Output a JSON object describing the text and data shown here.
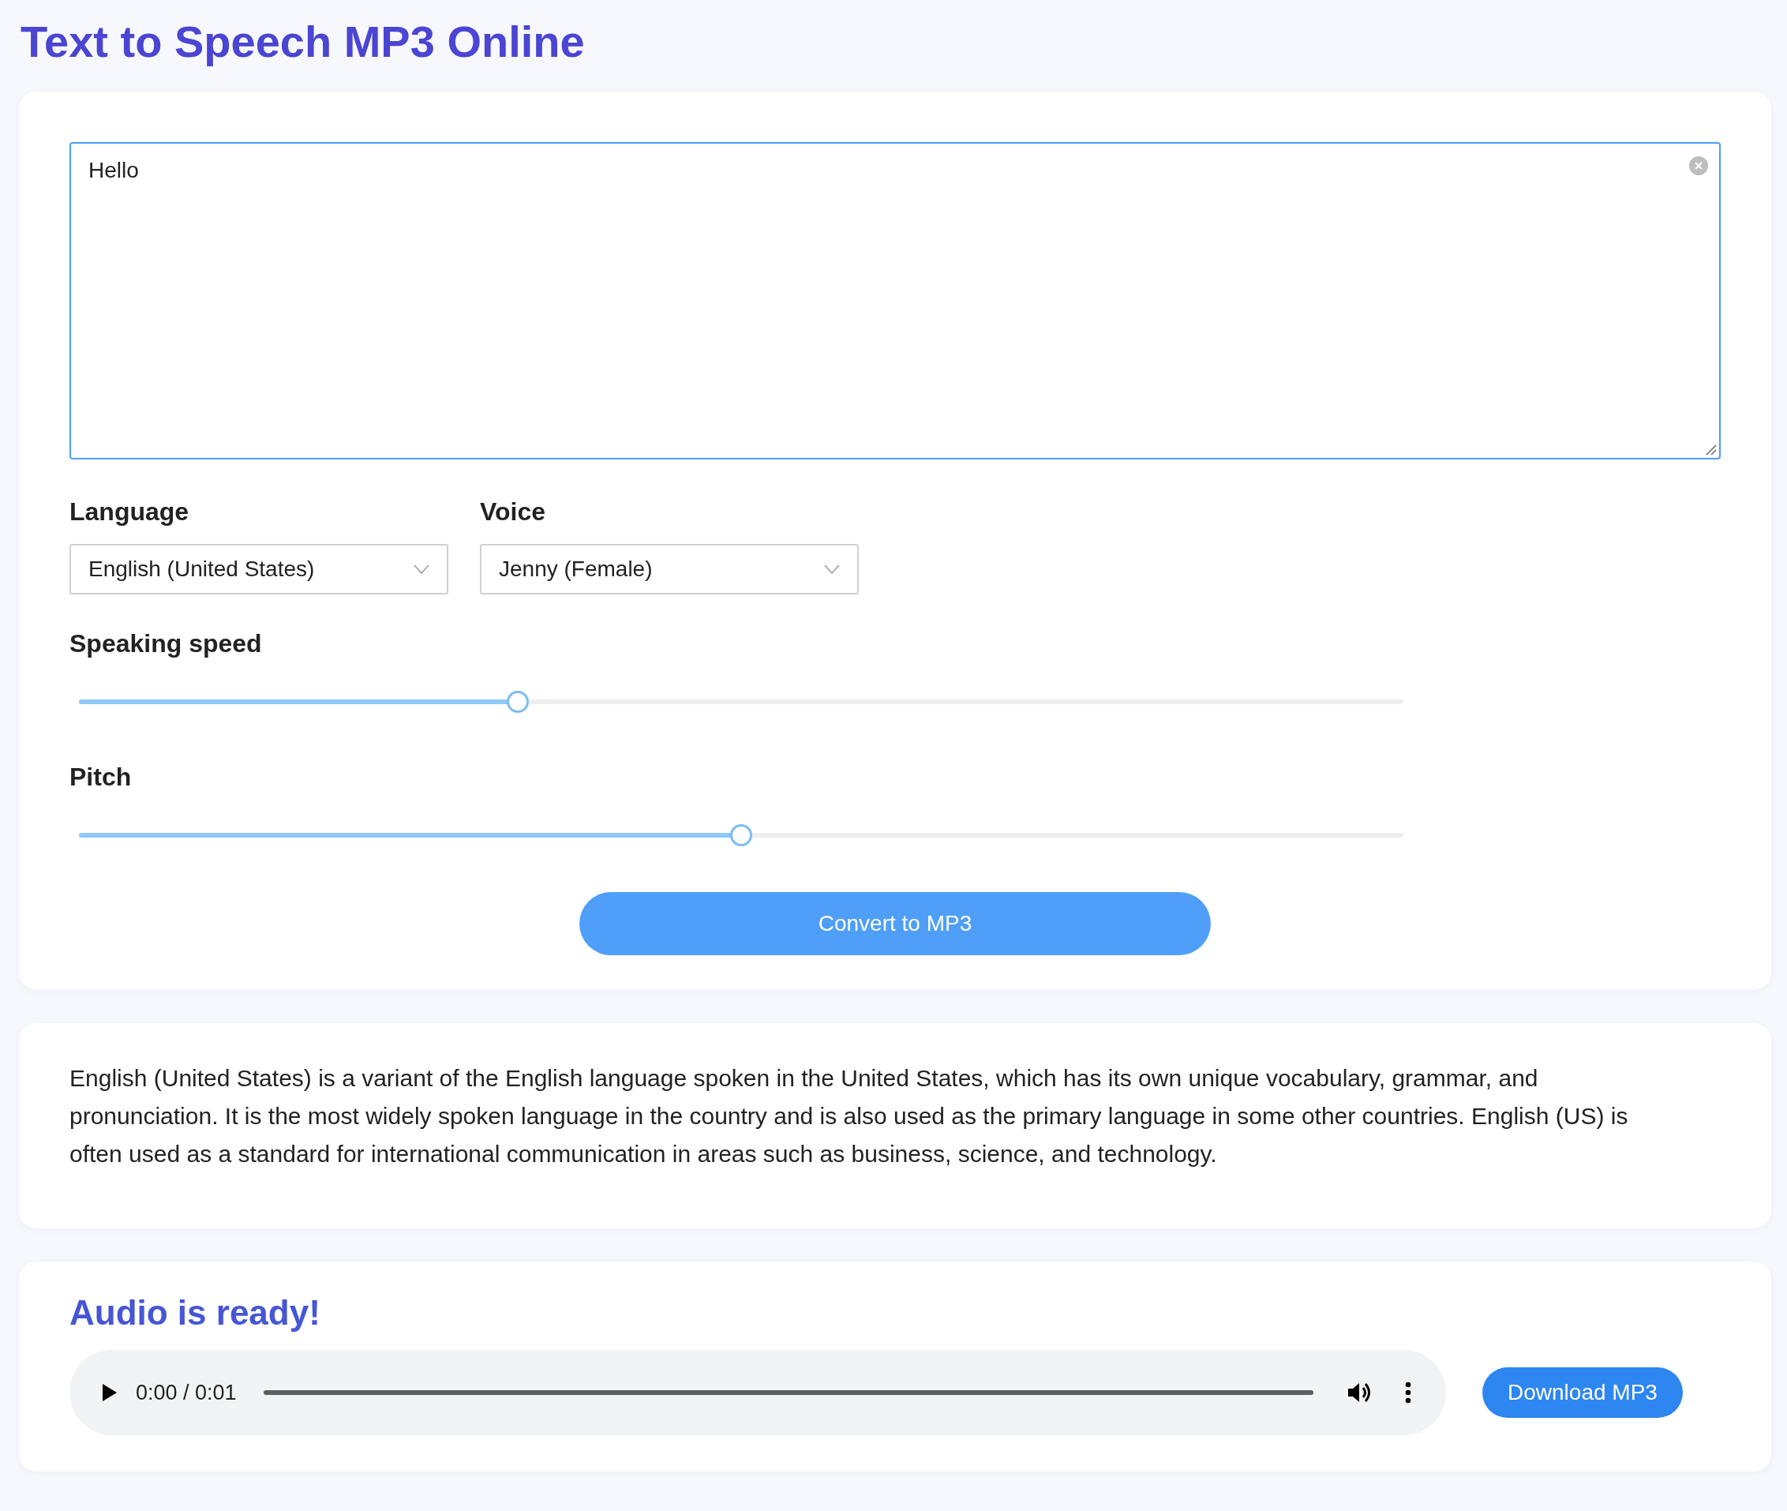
{
  "page_title": "Text to Speech MP3 Online",
  "text_input": {
    "value": "Hello"
  },
  "selects": [
    {
      "label": "Language",
      "value": "English (United States)"
    },
    {
      "label": "Voice",
      "value": "Jenny (Female)"
    }
  ],
  "sliders": [
    {
      "label": "Speaking speed",
      "level": 0.334
    },
    {
      "label": "Pitch",
      "level": 0.5
    }
  ],
  "convert_button": "Convert to MP3",
  "description": "English (United States) is a variant of the English language spoken in the United States, which has its own unique vocabulary, grammar, and pronunciation. It is the most widely spoken language in the country and is also used as the primary language in some other countries. English (US) is often used as a standard for international communication in areas such as business, science, and technology.",
  "result": {
    "heading": "Audio is ready!",
    "time": "0:00 / 0:01",
    "download_button": "Download MP3"
  }
}
